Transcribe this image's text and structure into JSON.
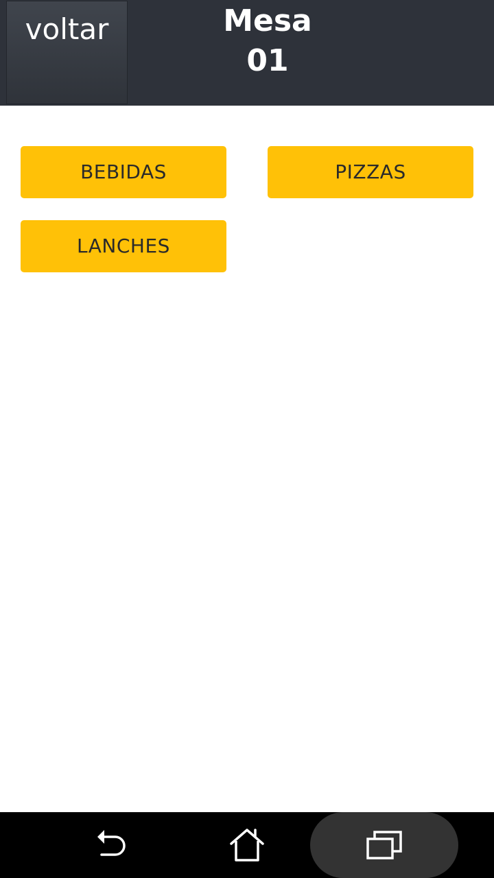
{
  "header": {
    "back_label": "voltar",
    "title_line1": "Mesa",
    "title_line2": "01"
  },
  "categories": [
    {
      "label": "BEBIDAS"
    },
    {
      "label": "PIZZAS"
    },
    {
      "label": "LANCHES"
    }
  ],
  "navbar": {
    "back_icon": "back-arrow-icon",
    "home_icon": "home-icon",
    "recents_icon": "recent-apps-icon"
  },
  "colors": {
    "header_bg": "#2e323a",
    "accent": "#ffc107",
    "navbar_bg": "#000000"
  }
}
